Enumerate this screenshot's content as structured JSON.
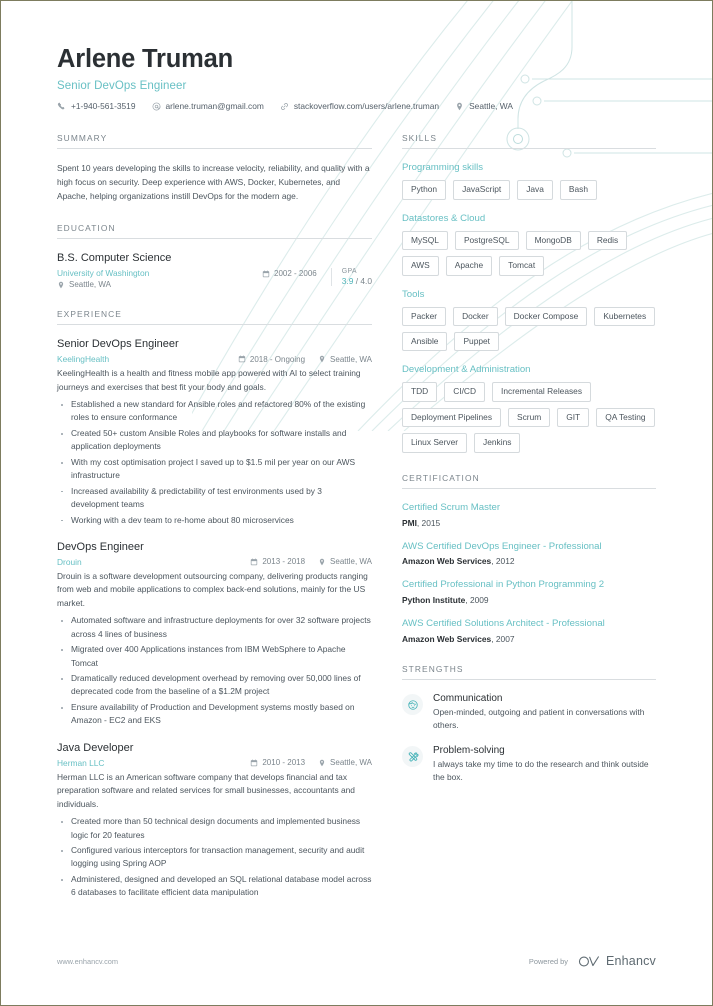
{
  "theme": {
    "accent": "#68c0c4",
    "accent_dark": "#3fb0b5",
    "text": "#4c565e",
    "heading": "#2b3034",
    "muted": "#7b858c",
    "rule": "#d9dde0",
    "page_border": "#7d7c5e"
  },
  "header": {
    "name": "Arlene Truman",
    "role": "Senior DevOps Engineer",
    "contacts": [
      {
        "icon": "phone-icon",
        "text": "+1-940-561-3519"
      },
      {
        "icon": "email-icon",
        "text": "arlene.truman@gmail.com"
      },
      {
        "icon": "link-icon",
        "text": "stackoverflow.com/users/arlene.truman"
      },
      {
        "icon": "location-pin-icon",
        "text": "Seattle, WA"
      }
    ]
  },
  "summary": {
    "title": "SUMMARY",
    "text": "Spent 10 years developing the skills to increase velocity, reliability, and quality with a high focus on security. Deep experience with AWS, Docker, Kubernetes, and Apache, helping organizations instill DevOps for the modern age."
  },
  "education": {
    "title": "EDUCATION",
    "items": [
      {
        "degree": "B.S. Computer Science",
        "school": "University of Washington",
        "location": "Seattle, WA",
        "dates": "2002 - 2006",
        "gpa_label": "GPA",
        "gpa_value": "3.9",
        "gpa_scale": "/ 4.0"
      }
    ]
  },
  "experience": {
    "title": "EXPERIENCE",
    "items": [
      {
        "role": "Senior DevOps Engineer",
        "company": "KeelingHealth",
        "dates": "2018 - Ongoing",
        "location": "Seattle, WA",
        "description": "KeelingHealth is a health and fitness mobile app powered with AI to select training journeys and exercises that best fit your body and goals.",
        "bullets": [
          "Established a new standard for Ansible roles and refactored 80% of the existing roles to ensure conformance",
          "Created 50+ custom Ansible Roles and playbooks for software installs and application deployments",
          "With my cost optimisation project I saved up to $1.5 mil per year on our AWS infrastructure",
          "Increased availability & predictability of test environments used by 3 development teams",
          "Working with a dev team to re-home about 80 microservices"
        ]
      },
      {
        "role": "DevOps Engineer",
        "company": "Drouin",
        "dates": "2013 - 2018",
        "location": "Seattle, WA",
        "description": "Drouin is a software development outsourcing company, delivering products ranging from web and mobile applications to complex back-end solutions, mainly for the US market.",
        "bullets": [
          "Automated software and infrastructure deployments for over 32 software projects across 4 lines of business",
          "Migrated over 400 Applications instances from IBM WebSphere to Apache Tomcat",
          "Dramatically reduced development overhead by removing over 50,000 lines of deprecated code from the baseline of a $1.2M project",
          "Ensure availability of Production and Development systems mostly based on Amazon - EC2 and EKS"
        ]
      },
      {
        "role": "Java Developer",
        "company": "Herman LLC",
        "dates": "2010 - 2013",
        "location": "Seattle, WA",
        "description": "Herman LLC is an American software company that develops financial and tax preparation software and related services for small businesses, accountants and individuals.",
        "bullets": [
          "Created more than 50 technical design documents and implemented business logic for 20 features",
          "Configured various interceptors for transaction management, security and audit logging using Spring AOP",
          "Administered, designed and developed an SQL relational database model across 6 databases to facilitate efficient data manipulation"
        ]
      }
    ]
  },
  "skills": {
    "title": "SKILLS",
    "groups": [
      {
        "name": "Programming skills",
        "items": [
          "Python",
          "JavaScript",
          "Java",
          "Bash"
        ]
      },
      {
        "name": "Datastores & Cloud",
        "items": [
          "MySQL",
          "PostgreSQL",
          "MongoDB",
          "Redis",
          "AWS",
          "Apache",
          "Tomcat"
        ]
      },
      {
        "name": "Tools",
        "items": [
          "Packer",
          "Docker",
          "Docker Compose",
          "Kubernetes",
          "Ansible",
          "Puppet"
        ]
      },
      {
        "name": "Development & Administration",
        "items": [
          "TDD",
          "CI/CD",
          "Incremental Releases",
          "Deployment Pipelines",
          "Scrum",
          "GIT",
          "QA Testing",
          "Linux Server",
          "Jenkins"
        ]
      }
    ]
  },
  "certification": {
    "title": "CERTIFICATION",
    "items": [
      {
        "name": "Certified Scrum Master",
        "issuer": "PMI",
        "year": "2015"
      },
      {
        "name": "AWS Certified DevOps Engineer - Professional",
        "issuer": "Amazon Web Services",
        "year": "2012"
      },
      {
        "name": "Certified Professional in Python Programming 2",
        "issuer": "Python Institute",
        "year": "2009"
      },
      {
        "name": "AWS Certified Solutions Architect - Professional",
        "issuer": "Amazon Web Services",
        "year": "2007"
      }
    ]
  },
  "strengths": {
    "title": "STRENGTHS",
    "items": [
      {
        "icon": "person-face-icon",
        "name": "Communication",
        "description": "Open-minded, outgoing and patient in conversations with others."
      },
      {
        "icon": "tools-crossed-icon",
        "name": "Problem-solving",
        "description": "I always take my time to do the research and think outside the box."
      }
    ]
  },
  "footer": {
    "url": "www.enhancv.com",
    "powered_by": "Powered by",
    "brand": "Enhancv"
  }
}
